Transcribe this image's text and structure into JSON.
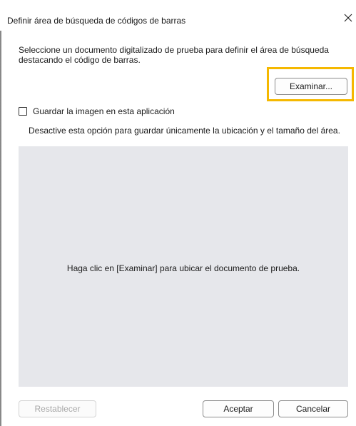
{
  "dialog": {
    "title": "Definir área de búsqueda de códigos de barras",
    "close_icon": "close-icon",
    "description": "Seleccione un documento digitalizado de prueba para definir el área de búsqueda destacando el código de barras.",
    "browse_label": "Examinar...",
    "save_image_checkbox": {
      "label": "Guardar la imagen en esta aplicación",
      "checked": false
    },
    "hint": "Desactive esta opción para guardar únicamente la ubicación y el tamaño del área.",
    "preview_message": "Haga clic en [Examinar] para ubicar el documento de prueba.",
    "buttons": {
      "reset": "Restablecer",
      "ok": "Aceptar",
      "cancel": "Cancelar"
    }
  },
  "colors": {
    "highlight": "#f5b800",
    "preview_bg": "#e6e7eb",
    "disabled_text": "#a8a8a8"
  }
}
